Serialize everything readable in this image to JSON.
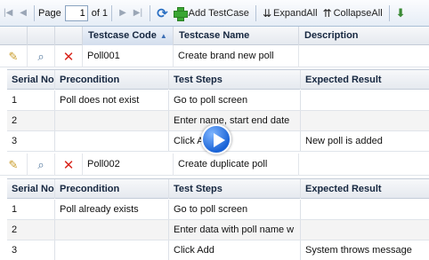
{
  "toolbar": {
    "page_label": "Page",
    "page_value": "1",
    "of_label": "of 1",
    "add_label": "Add TestCase",
    "expand_label": "ExpandAll",
    "collapse_label": "CollapseAll"
  },
  "columns": {
    "code": "Testcase Code",
    "name": "Testcase Name",
    "description": "Description"
  },
  "sub_columns": {
    "serial": "Serial No",
    "precondition": "Precondition",
    "steps": "Test Steps",
    "expected": "Expected Result"
  },
  "testcases": [
    {
      "code": "Poll001",
      "name": "Create brand new poll",
      "description": "",
      "steps": [
        {
          "serial": "1",
          "precondition": "Poll does not exist",
          "step": "Go to poll screen",
          "expected": ""
        },
        {
          "serial": "2",
          "precondition": "",
          "step": "Enter name, start end date",
          "expected": ""
        },
        {
          "serial": "3",
          "precondition": "",
          "step": "Click Add",
          "expected": "New poll is added"
        }
      ]
    },
    {
      "code": "Poll002",
      "name": "Create duplicate poll",
      "description": "",
      "steps": [
        {
          "serial": "1",
          "precondition": "Poll already exists",
          "step": "Go to poll screen",
          "expected": ""
        },
        {
          "serial": "2",
          "precondition": "",
          "step": "Enter data with poll name w",
          "expected": ""
        },
        {
          "serial": "3",
          "precondition": "",
          "step": "Click Add",
          "expected": "System throws message"
        }
      ]
    }
  ],
  "icons": {
    "first": "first-page-icon",
    "prev": "prev-page-icon",
    "next": "next-page-icon",
    "last": "last-page-icon",
    "refresh": "refresh-icon",
    "add": "add-icon",
    "expand": "expand-all-icon",
    "collapse": "collapse-all-icon",
    "export": "export-icon",
    "edit": "pencil-icon",
    "view": "view-icon",
    "delete": "delete-icon",
    "video": "play-icon"
  },
  "colors": {
    "toolbar_border": "#a9bfd6",
    "header_text": "#15263f",
    "delete_red": "#d9261c",
    "add_green": "#39a632",
    "play_blue": "#1a63d6"
  }
}
